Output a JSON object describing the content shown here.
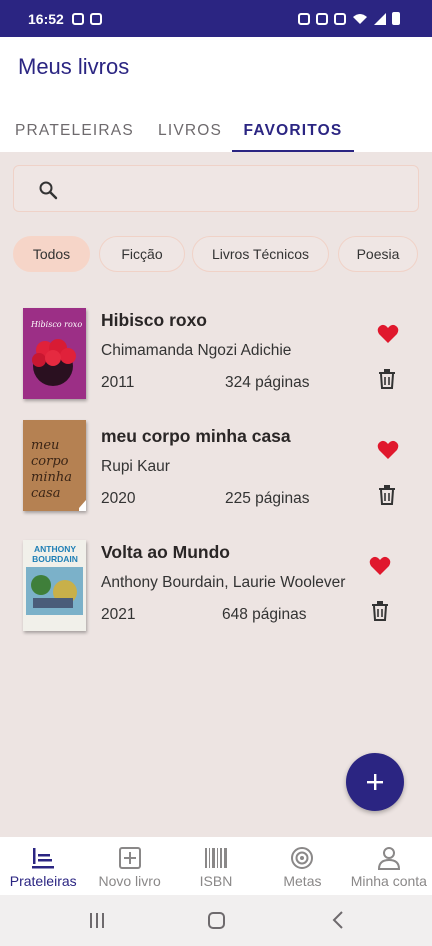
{
  "status_bar": {
    "time": "16:52"
  },
  "appbar": {
    "title": "Meus livros"
  },
  "tabs": [
    {
      "label": "PRATELEIRAS",
      "selected": false
    },
    {
      "label": "LIVROS",
      "selected": false
    },
    {
      "label": "FAVORITOS",
      "selected": true
    }
  ],
  "search": {
    "placeholder": ""
  },
  "chips": [
    {
      "label": "Todos",
      "selected": true
    },
    {
      "label": "Ficção",
      "selected": false
    },
    {
      "label": "Livros Técnicos",
      "selected": false
    },
    {
      "label": "Poesia",
      "selected": false
    }
  ],
  "books": [
    {
      "title": "Hibisco roxo",
      "author": "Chimamanda Ngozi Adichie",
      "year": "2011",
      "pages": "324 páginas",
      "favorite": true,
      "cover_text": "Hibisco roxo",
      "cover_color": "#9c2f86"
    },
    {
      "title": "meu corpo minha casa",
      "author": "Rupi Kaur",
      "year": "2020",
      "pages": "225 páginas",
      "favorite": true,
      "cover_text": "meu corpo minha casa",
      "cover_color": "#b58152"
    },
    {
      "title": "Volta ao Mundo",
      "author": "Anthony Bourdain, Laurie Woolever",
      "year": "2021",
      "pages": "648 páginas",
      "favorite": true,
      "cover_text": "ANTHONY BOURDAIN",
      "cover_color": "#f1f0ea"
    }
  ],
  "fab": {
    "icon": "plus-icon"
  },
  "bottom_nav": [
    {
      "label": "Prateleiras",
      "icon": "shelves-icon",
      "active": true
    },
    {
      "label": "Novo livro",
      "icon": "add-box-icon",
      "active": false
    },
    {
      "label": "ISBN",
      "icon": "barcode-icon",
      "active": false
    },
    {
      "label": "Metas",
      "icon": "target-icon",
      "active": false
    },
    {
      "label": "Minha conta",
      "icon": "person-icon",
      "active": false
    }
  ],
  "colors": {
    "primary": "#2b2582",
    "background": "#ede4e2",
    "chip_selected": "#f6d5c8",
    "heart": "#e0182d"
  }
}
